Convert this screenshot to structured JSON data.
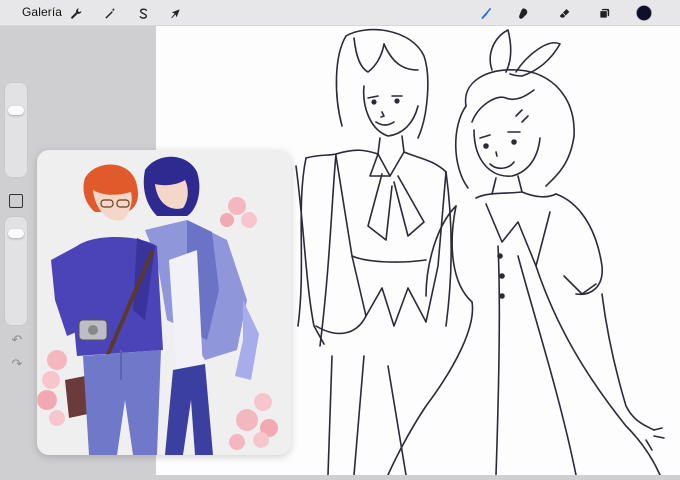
{
  "toolbar": {
    "gallery_label": "Galería",
    "left_tools": [
      {
        "name": "actions",
        "icon": "wrench-icon"
      },
      {
        "name": "adjustments",
        "icon": "magic-wand-icon"
      },
      {
        "name": "selection",
        "icon": "selection-s-icon"
      },
      {
        "name": "transform",
        "icon": "arrow-cursor-icon"
      }
    ],
    "right_tools": [
      {
        "name": "brush",
        "icon": "brush-icon",
        "active": true
      },
      {
        "name": "smudge",
        "icon": "smudge-icon"
      },
      {
        "name": "eraser",
        "icon": "eraser-icon"
      },
      {
        "name": "layers",
        "icon": "layers-icon"
      },
      {
        "name": "color",
        "icon": "color-swatch",
        "color": "#0f0f2a"
      }
    ]
  },
  "sidebar": {
    "brush_size_level": 0.75,
    "opacity_level": 0.9,
    "modify_icon": "square-icon",
    "undo_icon": "undo-icon",
    "redo_icon": "redo-icon"
  },
  "colors": {
    "accent": "#1b6ee6",
    "toolbar_bg": "#e7e7e9",
    "canvas_bg": "#fdfdfd",
    "ink": "#2a2a3a",
    "current_color": "#0f0f2a"
  },
  "reference_panel": {
    "description_icon": "reference-image"
  }
}
